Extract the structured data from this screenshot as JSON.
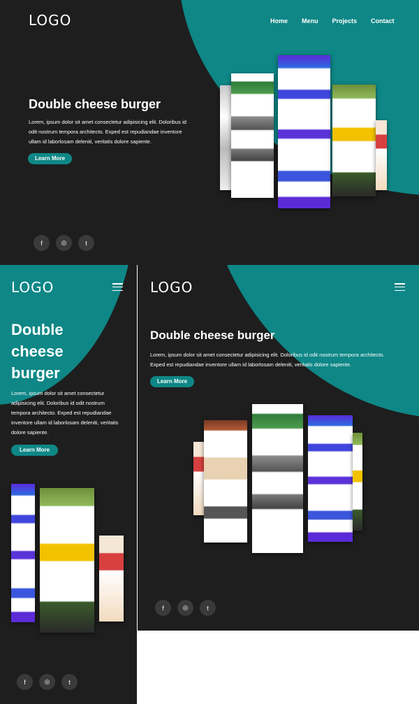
{
  "brand": {
    "logo": "LOGO",
    "accent": "#0e8786",
    "background": "#1e1e1e"
  },
  "nav": {
    "items": [
      "Home",
      "Menu",
      "Projects",
      "Contact"
    ]
  },
  "hero": {
    "title": "Double cheese burger",
    "body": "Lorem, ipsum dolor sit amet consectetur adipisicing elit. Doloribus id odit nostrum tempora architecto. Exped est repudiandae inventore ullam id laborlosam deleniti, veritatis dolore sapiente.",
    "cta": "Learn More"
  },
  "social": {
    "icons": [
      "facebook-icon",
      "instagram-icon",
      "twitter-icon"
    ],
    "glyphs": [
      "f",
      "◎",
      "t"
    ]
  }
}
